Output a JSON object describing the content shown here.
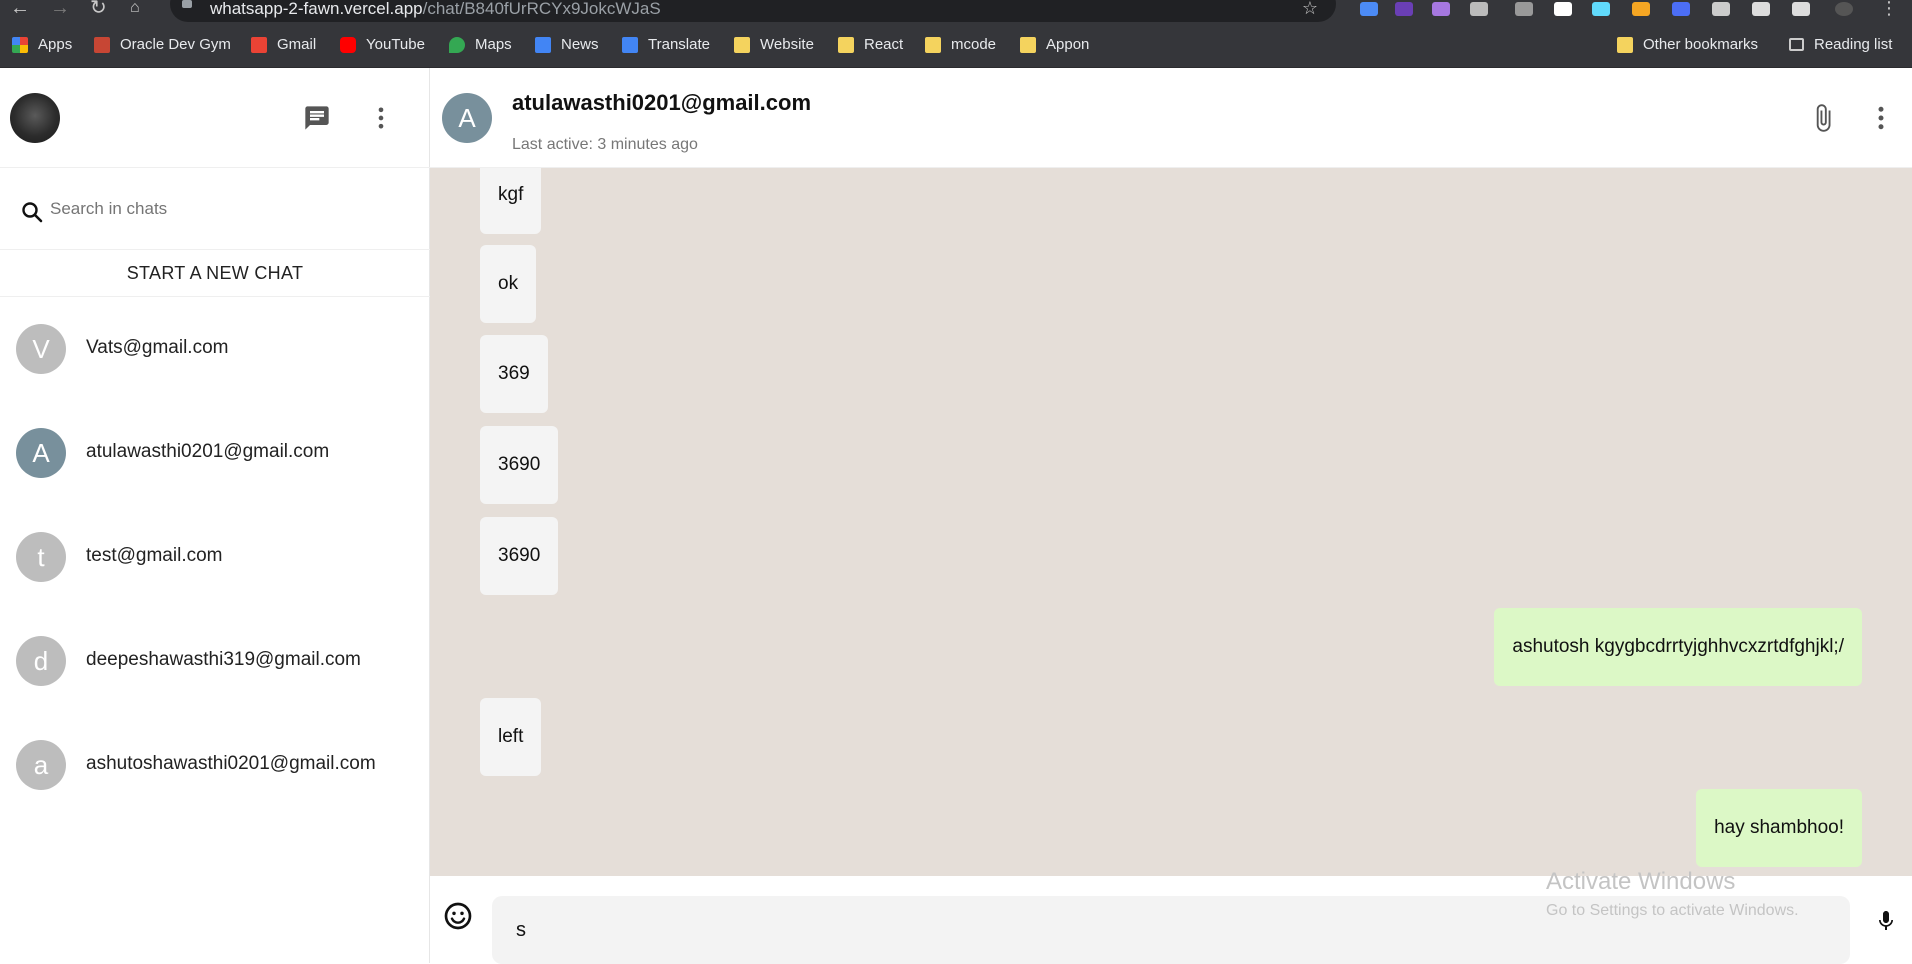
{
  "browser": {
    "url_host": "whatsapp-2-fawn.vercel.app",
    "url_path": "/chat/B840fUrRCYx9JokcWJaS",
    "bookmarks": [
      "Apps",
      "Oracle Dev Gym",
      "Gmail",
      "YouTube",
      "Maps",
      "News",
      "Translate",
      "Website",
      "React",
      "mcode",
      "Appon"
    ],
    "other_bookmarks": "Other bookmarks",
    "reading_list": "Reading list"
  },
  "sidebar": {
    "search_placeholder": "Search in chats",
    "new_chat_label": "START A NEW CHAT",
    "chats": [
      {
        "initial": "V",
        "email": "Vats@gmail.com",
        "avatar_color": "#bdbdbd"
      },
      {
        "initial": "A",
        "email": "atulawasthi0201@gmail.com",
        "avatar_color": "#78909c"
      },
      {
        "initial": "t",
        "email": "test@gmail.com",
        "avatar_color": "#bdbdbd"
      },
      {
        "initial": "d",
        "email": "deepeshawasthi319@gmail.com",
        "avatar_color": "#bdbdbd"
      },
      {
        "initial": "a",
        "email": "ashutoshawasthi0201@gmail.com",
        "avatar_color": "#bdbdbd"
      }
    ]
  },
  "chat": {
    "avatar_initial": "A",
    "title": "atulawasthi0201@gmail.com",
    "last_active": "Last active: 3 minutes ago",
    "messages": [
      {
        "text": "kgf",
        "sent": false
      },
      {
        "text": "ok",
        "sent": false
      },
      {
        "text": "369",
        "sent": false
      },
      {
        "text": "3690",
        "sent": false
      },
      {
        "text": "3690",
        "sent": false
      },
      {
        "text": "ashutosh kgygbcdrrtyjghhvcxzrtdfghjkl;/",
        "sent": true
      },
      {
        "text": "left",
        "sent": false
      },
      {
        "text": "hay shambhoo!",
        "sent": true
      }
    ]
  },
  "composer": {
    "value": "s"
  },
  "watermark": {
    "title": "Activate Windows",
    "subtitle": "Go to Settings to activate Windows."
  },
  "colors": {
    "chat_background": "#e5ded8",
    "sent_bubble": "#dcf8c6",
    "received_bubble": "#f4f4f4"
  }
}
